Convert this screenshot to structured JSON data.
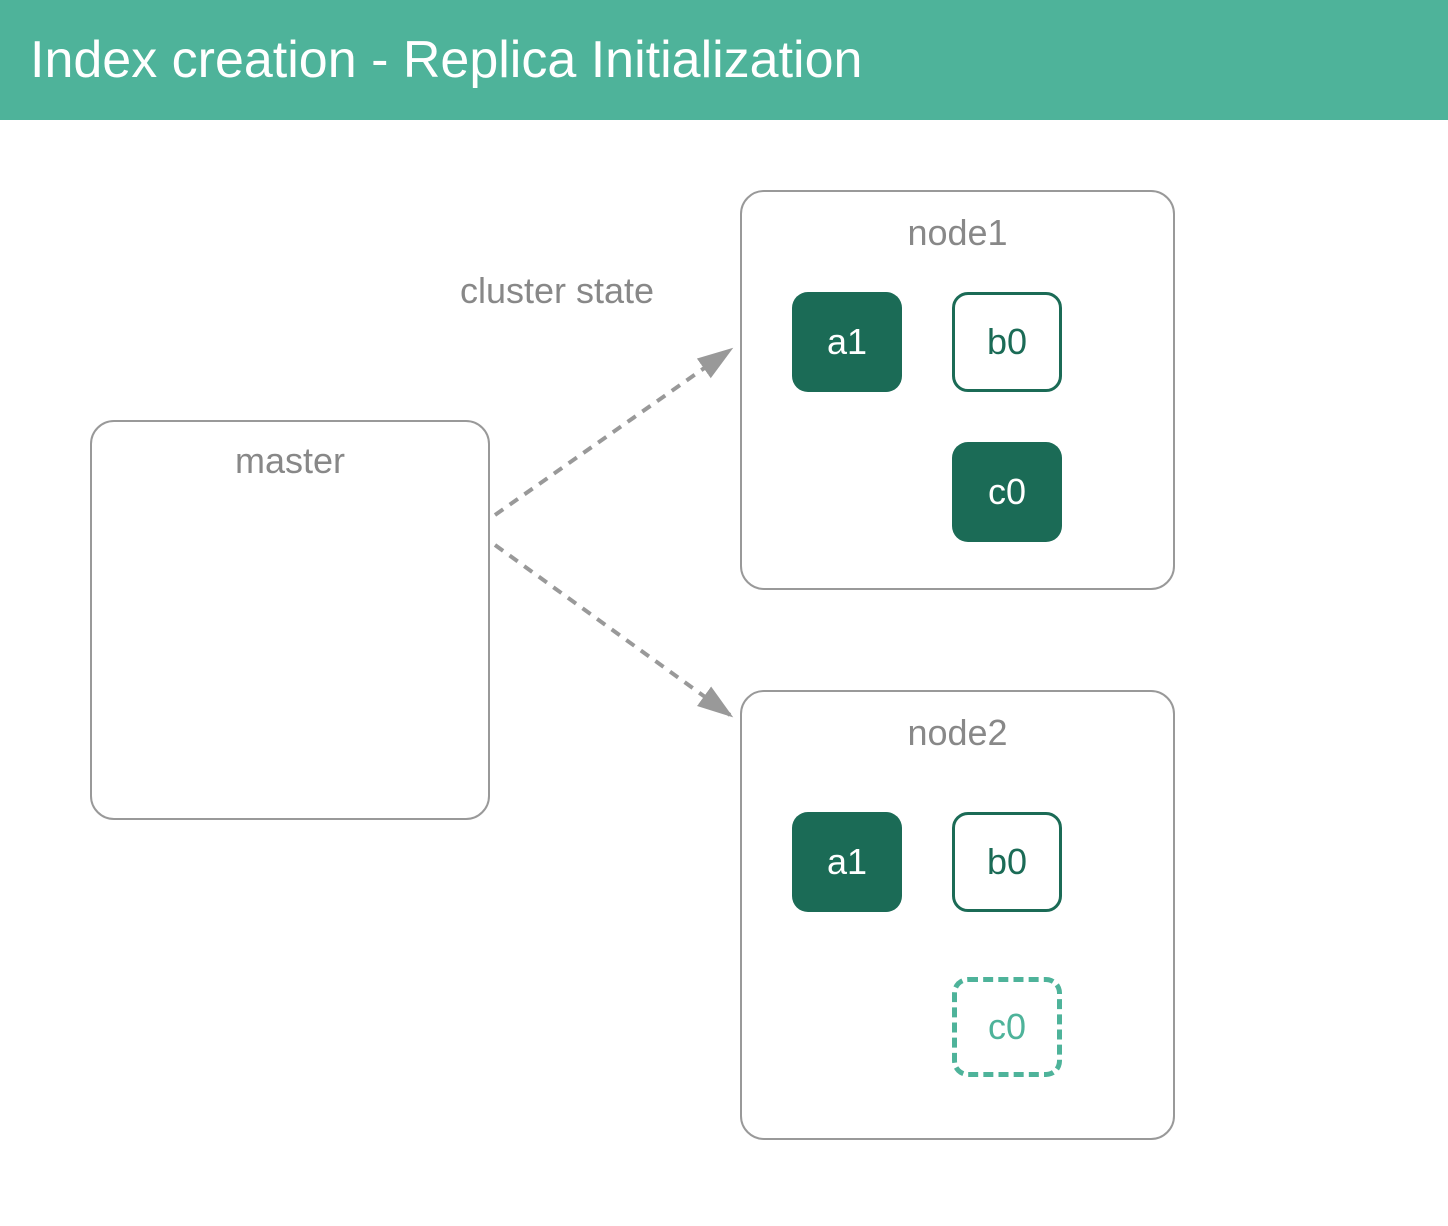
{
  "header": {
    "title": "Index creation - Replica Initialization"
  },
  "arrow_label": "cluster state",
  "master": {
    "label": "master"
  },
  "node1": {
    "label": "node1",
    "shards": {
      "a1": "a1",
      "b0": "b0",
      "c0": "c0"
    }
  },
  "node2": {
    "label": "node2",
    "shards": {
      "a1": "a1",
      "b0": "b0",
      "c0": "c0"
    }
  },
  "colors": {
    "accent": "#4eb39a",
    "primary_shard": "#1b6b56",
    "border": "#999"
  }
}
